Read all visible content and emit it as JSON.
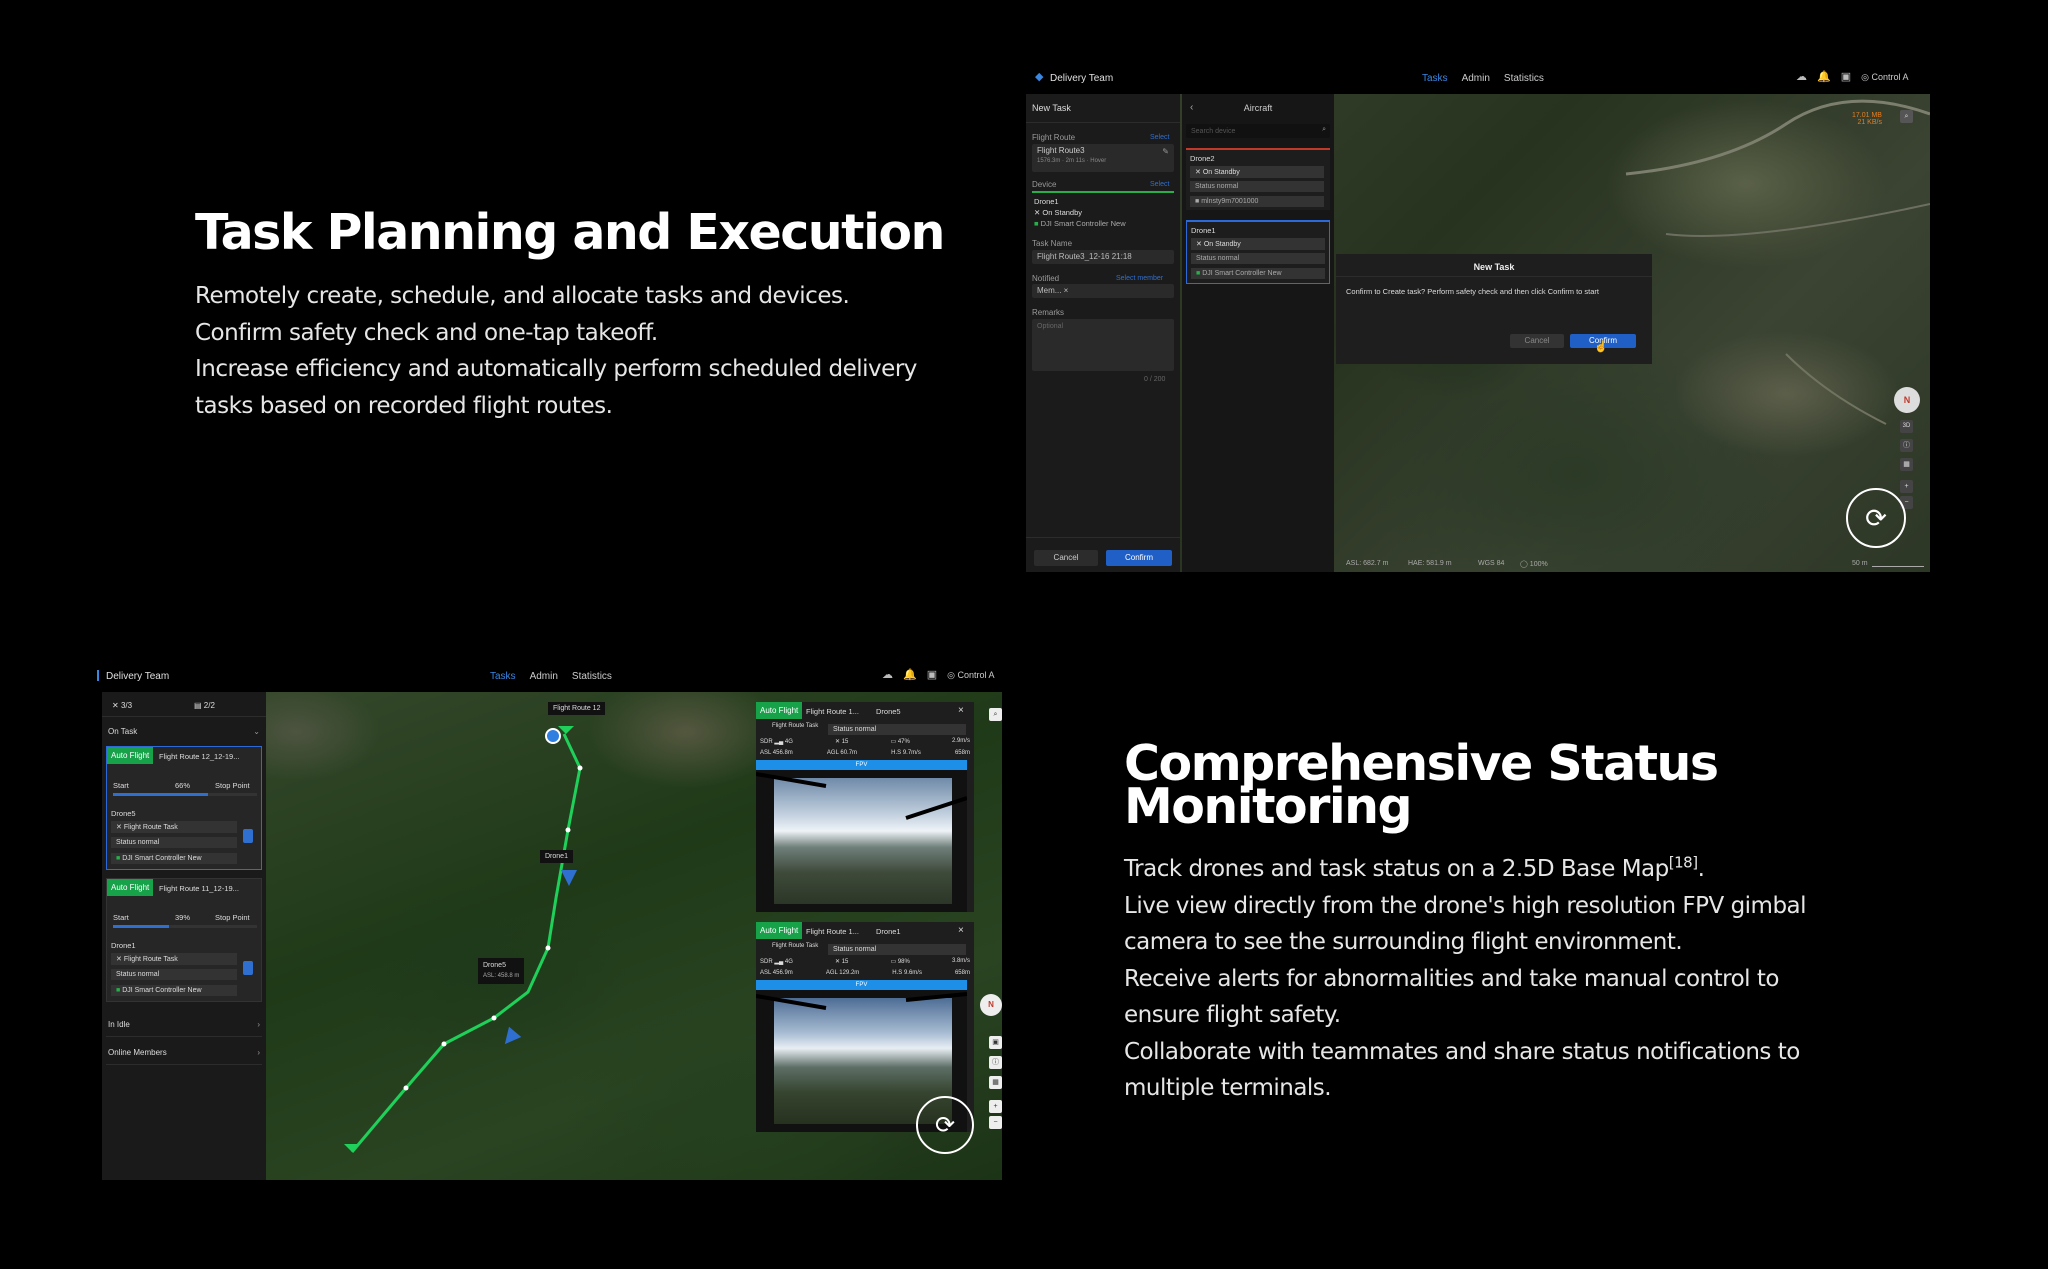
{
  "section1": {
    "heading": "Task Planning and Execution",
    "lines": [
      "Remotely create, schedule, and allocate tasks and devices.",
      "Confirm safety check and one-tap takeoff.",
      "Increase efficiency and automatically perform scheduled delivery",
      "tasks based on recorded flight routes."
    ]
  },
  "section2": {
    "heading_line1": "Comprehensive Status",
    "heading_line2": "Monitoring",
    "line1_text": "Track drones and task status on a 2.5D Base Map",
    "line1_ref": "[18]",
    "line1_end": ".",
    "lines": [
      "Live view directly from the drone's high resolution FPV gimbal",
      "camera to see the surrounding flight environment.",
      "Receive alerts for abnormalities and take manual control to",
      "ensure flight safety.",
      "Collaborate with teammates and share status notifications to",
      "multiple terminals."
    ]
  },
  "app1": {
    "team": "Delivery Team",
    "nav": [
      "Tasks",
      "Admin",
      "Statistics"
    ],
    "user": "Control A",
    "left_title": "New Task",
    "flight_route_label": "Flight Route",
    "select": "Select",
    "route_name": "Flight Route3",
    "route_meta": "1576.3m · 2m 11s · Hover",
    "device_label": "Device",
    "device_name": "Drone1",
    "device_status": "On Standby",
    "device_ctrl": "DJI Smart Controller New",
    "task_name_label": "Task Name",
    "task_name_value": "Flight Route3_12-16 21:18",
    "notified_label": "Notified",
    "select_member": "Select member",
    "member_value": "Mem... ×",
    "remarks_label": "Remarks",
    "remarks_placeholder": "Optional",
    "counter": "0 / 200",
    "cancel": "Cancel",
    "confirm": "Confirm",
    "aircraft_title": "Aircraft",
    "search_placeholder": "Search device",
    "drones": [
      {
        "name": "Drone2",
        "status": "On Standby",
        "state": "Status normal",
        "ctrl": "mlnsty9m7001000"
      },
      {
        "name": "Drone1",
        "status": "On Standby",
        "state": "Status normal",
        "ctrl": "DJI Smart Controller New"
      }
    ],
    "dialog_title": "New Task",
    "dialog_text": "Confirm to Create task? Perform safety check and then click Confirm to start",
    "dialog_cancel": "Cancel",
    "dialog_confirm": "Confirm",
    "weather": "17.01 MB",
    "weather2": "21 KB/s",
    "compass": "N",
    "view3d": "3D",
    "status_asl": "ASL: 682.7 m",
    "status_hae": "HAE: 581.9 m",
    "status_wgs": "WGS 84",
    "status_zoom": "100%",
    "scale": "50 m"
  },
  "app2": {
    "team": "Delivery Team",
    "nav": [
      "Tasks",
      "Admin",
      "Statistics"
    ],
    "user": "Control A",
    "count_drones": "3/3",
    "count_tasks": "2/2",
    "on_task": "On Task",
    "tasks": [
      {
        "tag": "Auto Flight",
        "route": "Flight Route 12_12-19...",
        "start": "Start",
        "pct": "66%",
        "stop": "Stop Point",
        "progress": 0.66,
        "drone": "Drone5",
        "task": "Flight Route Task",
        "status": "Status normal",
        "ctrl": "DJI Smart Controller New"
      },
      {
        "tag": "Auto Flight",
        "route": "Flight Route 11_12-19...",
        "start": "Start",
        "pct": "39%",
        "stop": "Stop Point",
        "progress": 0.39,
        "drone": "Drone1",
        "task": "Flight Route Task",
        "status": "Status normal",
        "ctrl": "DJI Smart Controller New"
      }
    ],
    "in_idle": "In Idle",
    "online_members": "Online Members",
    "map_label_route": "Flight Route 12",
    "map_label_drone1": "Drone1",
    "map_label_drone5": "Drone5",
    "map_label_drone5_asl": "ASL: 458.8 m",
    "video_panels": [
      {
        "tag": "Auto Flight",
        "route": "Flight Route 1...",
        "drone": "Drone5",
        "task": "Flight Route Task",
        "status": "Status normal",
        "sdr": "SDR",
        "sig": "4G",
        "sats": "15",
        "batt": "47%",
        "speed": "2.9m/s",
        "asl": "ASL 456.8m",
        "agl": "AGL 60.7m",
        "hs": "H.S 9.7m/s",
        "dist": "658m",
        "fpv": "FPV"
      },
      {
        "tag": "Auto Flight",
        "route": "Flight Route 1...",
        "drone": "Drone1",
        "task": "Flight Route Task",
        "status": "Status normal",
        "sdr": "SDR",
        "sig": "4G",
        "sats": "15",
        "batt": "98%",
        "speed": "3.8m/s",
        "asl": "ASL 456.9m",
        "agl": "AGL 129.2m",
        "hs": "H.S 9.6m/s",
        "dist": "658m",
        "fpv": "FPV"
      }
    ],
    "compass": "N"
  }
}
